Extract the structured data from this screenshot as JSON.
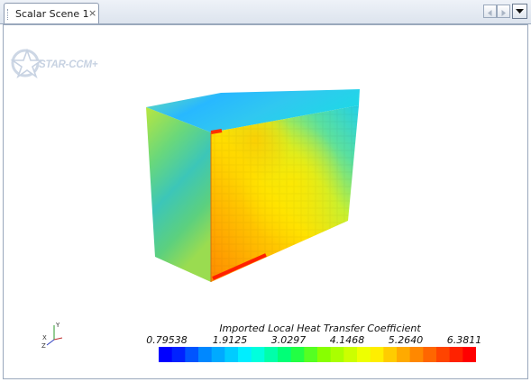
{
  "tab": {
    "label": "Scalar Scene 1",
    "close": "×"
  },
  "logo": {
    "text": "STAR-CCM+"
  },
  "legend": {
    "title": "Imported Local Heat Transfer Coefficient",
    "ticks": [
      "0.79538",
      "1.9125",
      "3.0297",
      "4.1468",
      "5.2640",
      "6.3811"
    ],
    "colors": [
      "#0000ff",
      "#0022ff",
      "#0055ff",
      "#0088ff",
      "#00aaff",
      "#00ccff",
      "#00eeff",
      "#00ffdd",
      "#00ffaa",
      "#00ff77",
      "#22ff44",
      "#55ff22",
      "#88ff00",
      "#aaff00",
      "#ccff00",
      "#eeff00",
      "#ffee00",
      "#ffcc00",
      "#ffaa00",
      "#ff8800",
      "#ff6600",
      "#ff4400",
      "#ff2200",
      "#ff0000"
    ]
  },
  "axes": {
    "x": "X",
    "y": "Y",
    "z": "Z"
  },
  "icons": {
    "nav_left": "chevron-left-icon",
    "nav_right": "chevron-right-icon",
    "menu": "dropdown-arrow-icon"
  }
}
